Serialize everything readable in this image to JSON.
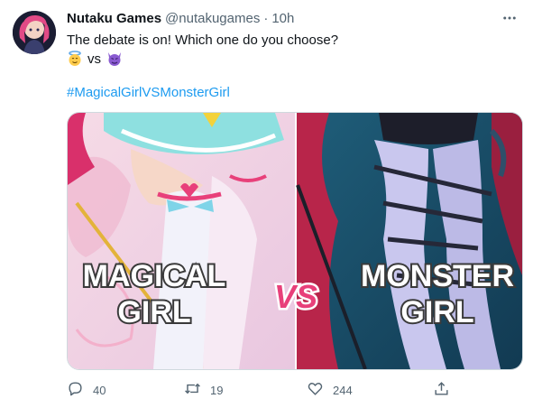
{
  "tweet": {
    "author_name": "Nutaku Games",
    "handle": "@nutakugames",
    "separator": "·",
    "time": "10h",
    "text": "The debate is on! Which one do you choose?",
    "vs_text": "vs",
    "hashtag": "#MagicalGirlVSMonsterGirl"
  },
  "media": {
    "left_caption_line1": "MAGICAL",
    "left_caption_line2": "GIRL",
    "center_text": "VS",
    "right_caption_line1": "MONSTER",
    "right_caption_line2": "GIRL"
  },
  "actions": {
    "reply_count": "40",
    "retweet_count": "19",
    "like_count": "244"
  },
  "icons": [
    "more-icon",
    "angel-emoji-icon",
    "devil-emoji-icon",
    "reply-icon",
    "retweet-icon",
    "like-icon",
    "share-icon"
  ],
  "colors": {
    "link": "#1d9bf0",
    "muted": "#536471",
    "vs_pink": "#e8407a"
  }
}
